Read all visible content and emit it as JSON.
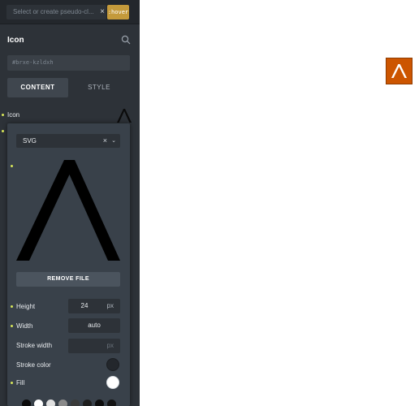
{
  "topbar": {
    "pseudo_placeholder": "Select or create pseudo-cl...",
    "clear_glyph": "×",
    "state_badge": ":hover"
  },
  "panel": {
    "title": "Icon",
    "element_id": "#brxe-kzldxh",
    "tabs": [
      {
        "label": "CONTENT",
        "active": true
      },
      {
        "label": "STYLE",
        "active": false
      }
    ],
    "icon_field_label": "Icon"
  },
  "icon_popup": {
    "library_select": {
      "value": "SVG",
      "clear_glyph": "×",
      "chevron_glyph": "⌄"
    },
    "remove_button": "REMOVE FILE",
    "controls": [
      {
        "label": "Height",
        "value": "24",
        "unit": "px"
      },
      {
        "label": "Width",
        "value": "auto",
        "unit": ""
      },
      {
        "label": "Stroke width",
        "value": "",
        "unit": "px"
      },
      {
        "label": "Stroke color",
        "swatch": "#23272c"
      },
      {
        "label": "Fill",
        "swatch": "#ffffff"
      }
    ],
    "palette": [
      "#0a0a0a",
      "#ffffff",
      "#e0e0e0",
      "#8a8a8a",
      "#3a3a3a",
      "#1e1e1e",
      "#0d0d0d",
      "#141414"
    ]
  },
  "colors": {
    "panel_bg": "#2d3238",
    "popup_bg": "#39414a",
    "accent_badge": "#c49a3b",
    "indicator_dot": "#d8e65a",
    "canvas_icon_bg": "#cc5500"
  },
  "icons": [
    "search-icon",
    "caret-up-icon",
    "close-icon",
    "chevron-down-icon"
  ]
}
